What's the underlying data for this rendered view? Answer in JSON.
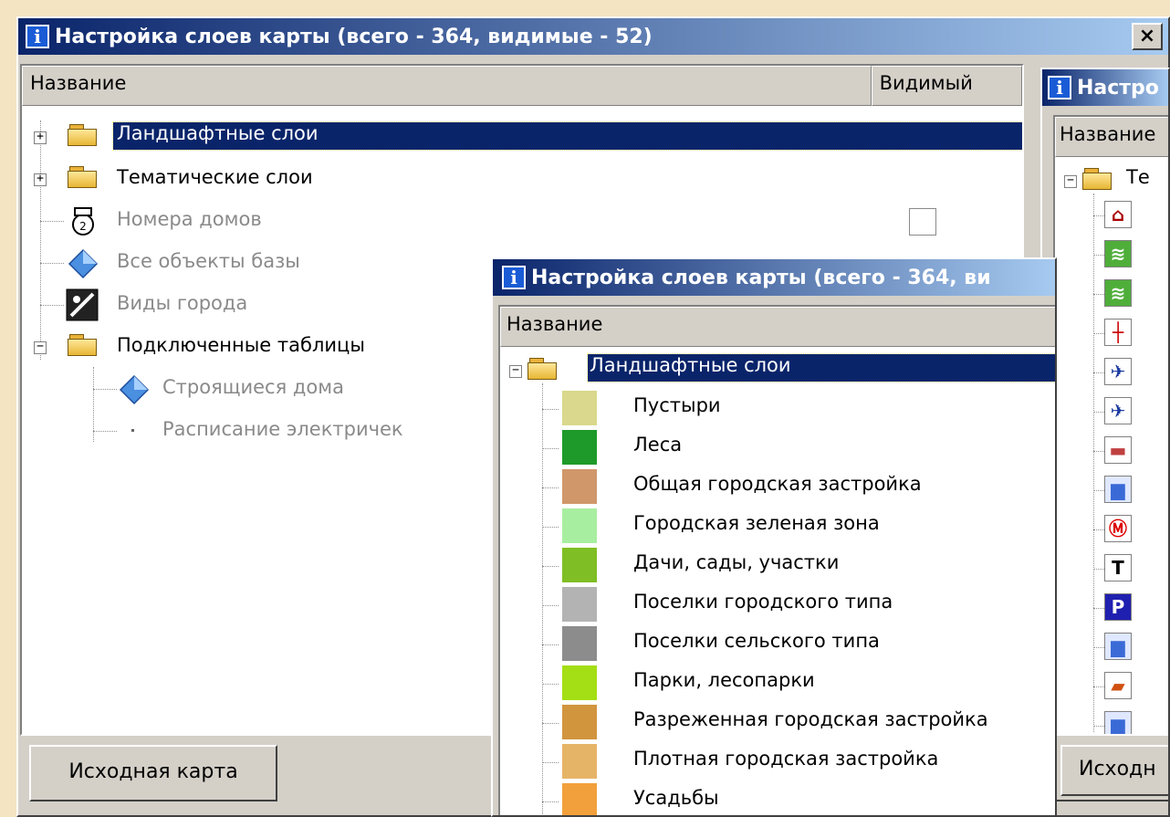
{
  "window1": {
    "title": "Настройка слоев карты (всего - 364, видимые - 52)",
    "close_label": "×",
    "col_name": "Название",
    "col_visible": "Видимый",
    "rows": [
      {
        "label": "Ландшафтные слои",
        "selected": true
      },
      {
        "label": "Тематические слои"
      },
      {
        "label": "Номера домов",
        "dim": true
      },
      {
        "label": "Все объекты базы",
        "dim": true
      },
      {
        "label": "Виды города",
        "dim": true
      },
      {
        "label": "Подключенные таблицы"
      },
      {
        "label": "Строящиеся дома",
        "dim": true
      },
      {
        "label": "Расписание электричек",
        "dim": true
      }
    ],
    "button_label": "Исходная карта"
  },
  "window2": {
    "title": "Настройка слоев карты (всего - 364, ви",
    "col_name": "Название",
    "root_label": "Ландшафтные слои",
    "items": [
      {
        "label": "Пустыри",
        "color": "#d9d88c"
      },
      {
        "label": "Леса",
        "color": "#1e9a2a"
      },
      {
        "label": "Общая городская застройка",
        "color": "#d0976a"
      },
      {
        "label": "Городская зеленая зона",
        "color": "#a8eea0"
      },
      {
        "label": "Дачи, сады, участки",
        "color": "#7fbe24"
      },
      {
        "label": "Поселки городского типа",
        "color": "#b3b3b3"
      },
      {
        "label": "Поселки сельского типа",
        "color": "#8c8c8c"
      },
      {
        "label": "Парки, лесопарки",
        "color": "#a4de14"
      },
      {
        "label": "Разреженная городская застройка",
        "color": "#d1953e"
      },
      {
        "label": "Плотная городская застройка",
        "color": "#e6b466"
      },
      {
        "label": "Усадьбы",
        "color": "#f2a03c"
      }
    ]
  },
  "window3": {
    "title": "Настро",
    "col_name": "Название",
    "root_label": "Те",
    "button_label": "Исходн",
    "icons": [
      "building-icon",
      "meadow-icon",
      "meadow-icon",
      "pipe-icon",
      "airplane-icon",
      "airplane-icon",
      "car-icon",
      "truck-icon",
      "metro-icon",
      "tram-stop-icon",
      "parking-icon",
      "truck-icon",
      "car-service-icon",
      "truck-icon"
    ]
  }
}
